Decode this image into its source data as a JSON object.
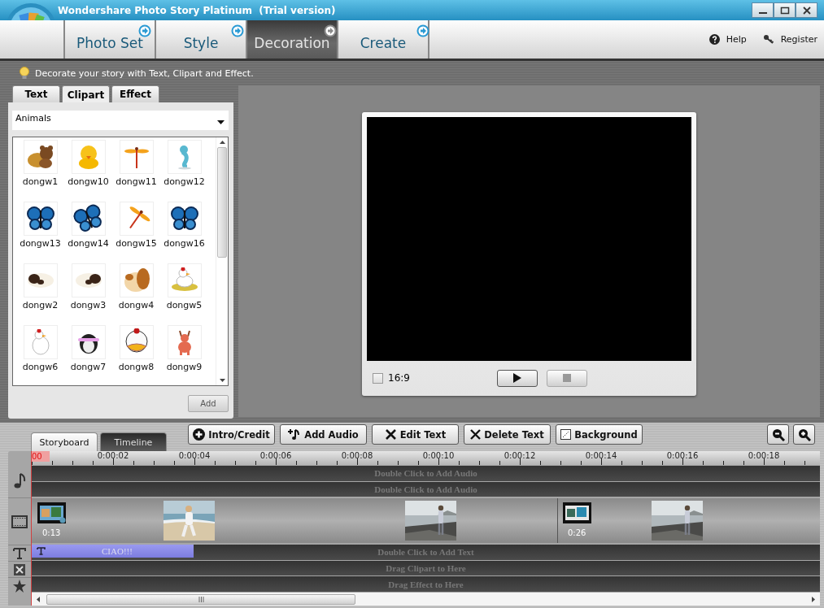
{
  "window": {
    "title": "Wondershare Photo Story Platinum  (Trial version)"
  },
  "nav": {
    "tabs": [
      {
        "label": "Photo Set",
        "selected": false
      },
      {
        "label": "Style",
        "selected": false
      },
      {
        "label": "Decoration",
        "selected": true
      },
      {
        "label": "Create",
        "selected": false
      }
    ],
    "links": [
      {
        "label": "Help",
        "kind": "help"
      },
      {
        "label": "Register",
        "kind": "register"
      }
    ]
  },
  "hint": "Decorate your story with Text, Clipart and Effect.",
  "panel": {
    "tabs": [
      {
        "label": "Text",
        "selected": false
      },
      {
        "label": "Clipart",
        "selected": true
      },
      {
        "label": "Effect",
        "selected": false
      }
    ],
    "category": "Animals",
    "clipart": [
      {
        "name": "dongw1"
      },
      {
        "name": "dongw10"
      },
      {
        "name": "dongw11"
      },
      {
        "name": "dongw12"
      },
      {
        "name": "dongw13"
      },
      {
        "name": "dongw14"
      },
      {
        "name": "dongw15"
      },
      {
        "name": "dongw16"
      },
      {
        "name": "dongw2"
      },
      {
        "name": "dongw3"
      },
      {
        "name": "dongw4"
      },
      {
        "name": "dongw5"
      },
      {
        "name": "dongw6"
      },
      {
        "name": "dongw7"
      },
      {
        "name": "dongw8"
      },
      {
        "name": "dongw9"
      }
    ],
    "add_button": {
      "label": "Add",
      "disabled": true
    }
  },
  "preview": {
    "aspect": {
      "label": "16:9",
      "checked": false
    },
    "stop_disabled": true
  },
  "bottom": {
    "view_tabs": [
      {
        "label": "Storyboard",
        "selected": false
      },
      {
        "label": "Timeline",
        "selected": true
      }
    ],
    "toolbar": [
      {
        "label": "Intro/Credit",
        "kind": "intro"
      },
      {
        "label": "Add Audio",
        "kind": "audio"
      },
      {
        "label": "Edit Text",
        "kind": "edit"
      },
      {
        "label": "Delete Text",
        "kind": "delete"
      },
      {
        "label": "Background",
        "kind": "background"
      }
    ],
    "ruler": {
      "playhead": "00",
      "ticks": [
        "0:00:02",
        "0:00:04",
        "0:00:06",
        "0:00:08",
        "0:00:10",
        "0:00:12",
        "0:00:14",
        "0:00:16",
        "0:00:18"
      ]
    },
    "audio_tracks": [
      "Double Click to Add Audio",
      "Double Click to Add Audio"
    ],
    "video_clips": [
      {
        "kind": "slideshow",
        "duration": "0:13"
      },
      {
        "kind": "picture"
      },
      {
        "kind": "picture"
      },
      {
        "kind": "slideshow",
        "duration": "0:26"
      },
      {
        "kind": "picture"
      }
    ],
    "text_track": {
      "caption": "CIAO!!!",
      "placeholder": "Double Click to Add Text"
    },
    "clipart_track": "Drag Clipart to Here",
    "effect_track": "Drag Effect to Here"
  }
}
